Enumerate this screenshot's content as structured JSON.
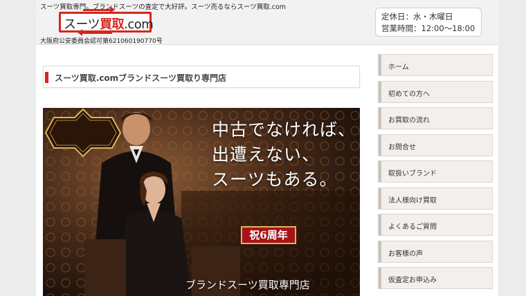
{
  "header": {
    "tagline": "スーツ買取専門。ブランドスーツの査定で大好評。スーツ売るならスーツ買取.com",
    "logo": {
      "part1": "スーツ",
      "part2": "買取",
      "part3": ".com"
    },
    "license": "大阪府公安委員会認可第621060190770号",
    "hours": {
      "closed": "定休日：水・木曜日",
      "open": "営業時間：12:00〜18:00"
    }
  },
  "main": {
    "title": "スーツ買取.comブランドスーツ買取り専門店",
    "hero": {
      "line1": "中古でなければ、",
      "line2": "出遭えない、",
      "line3": "スーツもある。",
      "badge": "祝6周年",
      "subtitle": "ブランドスーツ買取専門店"
    }
  },
  "sidebar": {
    "items": [
      {
        "label": "ホーム"
      },
      {
        "label": "初めての方へ"
      },
      {
        "label": "お買取の流れ"
      },
      {
        "label": "お問合せ"
      },
      {
        "label": "取扱いブランド"
      },
      {
        "label": "法人様向け買取"
      },
      {
        "label": "よくあるご質問"
      },
      {
        "label": "お客様の声"
      },
      {
        "label": "仮査定お申込み"
      }
    ]
  },
  "colors": {
    "accent": "#d6261c",
    "badge": "#a8121a",
    "gold": "#e1b55a"
  }
}
